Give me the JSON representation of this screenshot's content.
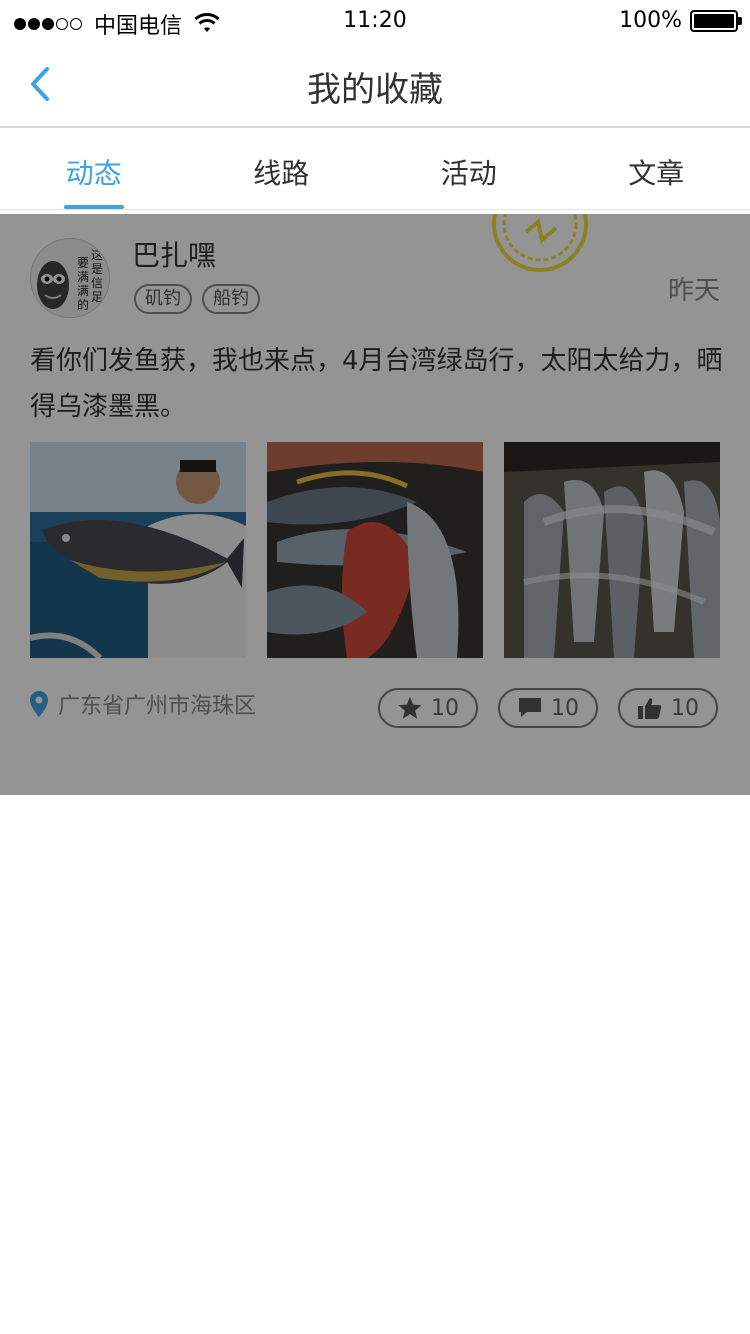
{
  "status_bar": {
    "carrier": "中国电信",
    "time": "11:20",
    "battery": "100%"
  },
  "nav": {
    "title": "我的收藏"
  },
  "tabs": [
    {
      "label": "动态",
      "active": true
    },
    {
      "label": "线路",
      "active": false
    },
    {
      "label": "活动",
      "active": false
    },
    {
      "label": "文章",
      "active": false
    }
  ],
  "post": {
    "username": "巴扎嘿",
    "tags": [
      "矶钓",
      "船钓"
    ],
    "time": "昨天",
    "text": "看你们发鱼获，我也来点，4月台湾绿岛行，太阳太给力，晒得乌漆墨黑。",
    "location": "广东省广州市海珠区",
    "favorites": "10",
    "comments": "10",
    "likes": "10",
    "avatar_text": [
      "这",
      "是",
      "信",
      "要",
      "满",
      "满",
      "的",
      "足"
    ]
  },
  "colors": {
    "accent": "#3ea3e6"
  }
}
